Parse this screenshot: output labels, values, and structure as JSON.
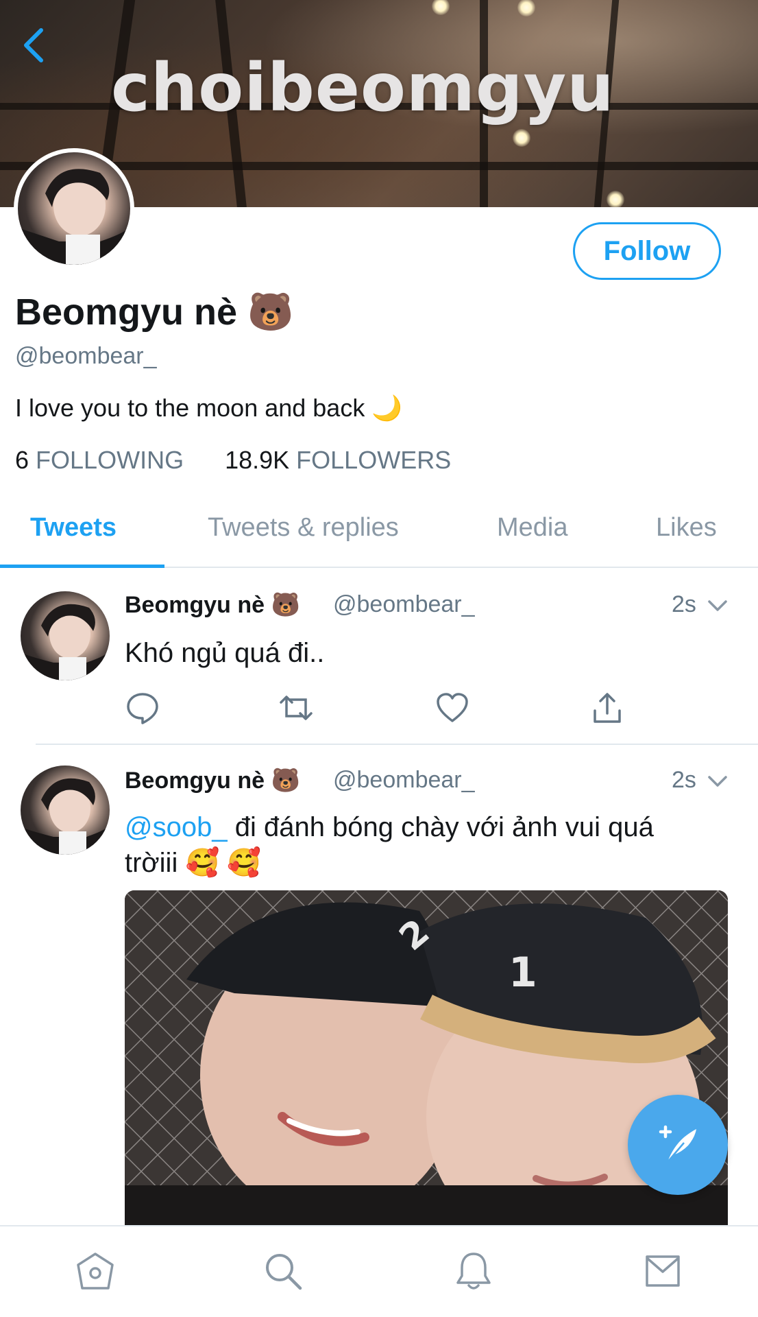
{
  "header": {
    "banner_text": "choibeomgyu",
    "back_icon": "chevron-left-icon"
  },
  "profile": {
    "display_name": "Beomgyu nè 🐻",
    "handle": "@beombear_",
    "bio": "I love you to the moon and back 🌙",
    "following_count": "6",
    "following_label": "FOLLOWING",
    "followers_count": "18.9K",
    "followers_label": "FOLLOWERS",
    "follow_button": "Follow"
  },
  "tabs": [
    {
      "label": "Tweets",
      "active": true
    },
    {
      "label": "Tweets & replies",
      "active": false
    },
    {
      "label": "Media",
      "active": false
    },
    {
      "label": "Likes",
      "active": false
    }
  ],
  "tweets": [
    {
      "name": "Beomgyu nè 🐻",
      "handle": "@beombear_",
      "time": "2s",
      "text": "Khó ngủ quá đi.."
    },
    {
      "name": "Beomgyu nè 🐻",
      "handle": "@beombear_",
      "time": "2s",
      "mention": "@soob_",
      "text_line1": " đi đánh bóng chày với ảnh vui quá",
      "text_line2": "trờiii 🥰 🥰"
    }
  ],
  "action_icons": [
    "reply-icon",
    "retweet-icon",
    "like-icon",
    "share-icon"
  ],
  "bottom_nav": [
    "home-icon",
    "search-icon",
    "notifications-icon",
    "messages-icon"
  ],
  "colors": {
    "accent": "#1da1f2",
    "secondary_text": "#657786",
    "divider": "#e1e8ed"
  }
}
